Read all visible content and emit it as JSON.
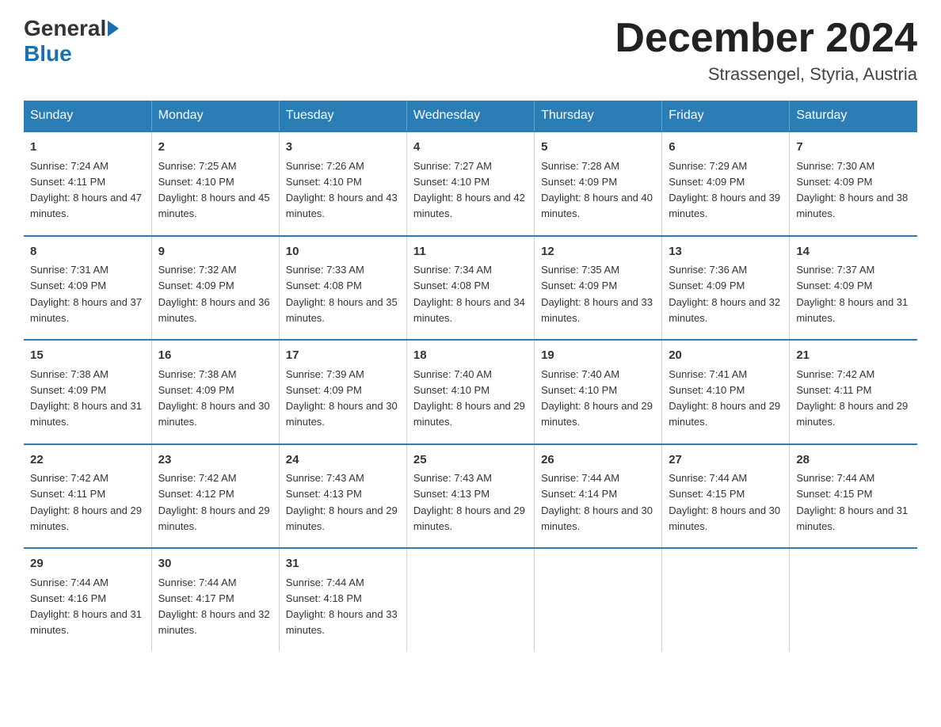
{
  "header": {
    "logo_general": "General",
    "logo_blue": "Blue",
    "month_title": "December 2024",
    "location": "Strassengel, Styria, Austria"
  },
  "days_of_week": [
    "Sunday",
    "Monday",
    "Tuesday",
    "Wednesday",
    "Thursday",
    "Friday",
    "Saturday"
  ],
  "weeks": [
    [
      {
        "day": "1",
        "sunrise": "7:24 AM",
        "sunset": "4:11 PM",
        "daylight": "8 hours and 47 minutes."
      },
      {
        "day": "2",
        "sunrise": "7:25 AM",
        "sunset": "4:10 PM",
        "daylight": "8 hours and 45 minutes."
      },
      {
        "day": "3",
        "sunrise": "7:26 AM",
        "sunset": "4:10 PM",
        "daylight": "8 hours and 43 minutes."
      },
      {
        "day": "4",
        "sunrise": "7:27 AM",
        "sunset": "4:10 PM",
        "daylight": "8 hours and 42 minutes."
      },
      {
        "day": "5",
        "sunrise": "7:28 AM",
        "sunset": "4:09 PM",
        "daylight": "8 hours and 40 minutes."
      },
      {
        "day": "6",
        "sunrise": "7:29 AM",
        "sunset": "4:09 PM",
        "daylight": "8 hours and 39 minutes."
      },
      {
        "day": "7",
        "sunrise": "7:30 AM",
        "sunset": "4:09 PM",
        "daylight": "8 hours and 38 minutes."
      }
    ],
    [
      {
        "day": "8",
        "sunrise": "7:31 AM",
        "sunset": "4:09 PM",
        "daylight": "8 hours and 37 minutes."
      },
      {
        "day": "9",
        "sunrise": "7:32 AM",
        "sunset": "4:09 PM",
        "daylight": "8 hours and 36 minutes."
      },
      {
        "day": "10",
        "sunrise": "7:33 AM",
        "sunset": "4:08 PM",
        "daylight": "8 hours and 35 minutes."
      },
      {
        "day": "11",
        "sunrise": "7:34 AM",
        "sunset": "4:08 PM",
        "daylight": "8 hours and 34 minutes."
      },
      {
        "day": "12",
        "sunrise": "7:35 AM",
        "sunset": "4:09 PM",
        "daylight": "8 hours and 33 minutes."
      },
      {
        "day": "13",
        "sunrise": "7:36 AM",
        "sunset": "4:09 PM",
        "daylight": "8 hours and 32 minutes."
      },
      {
        "day": "14",
        "sunrise": "7:37 AM",
        "sunset": "4:09 PM",
        "daylight": "8 hours and 31 minutes."
      }
    ],
    [
      {
        "day": "15",
        "sunrise": "7:38 AM",
        "sunset": "4:09 PM",
        "daylight": "8 hours and 31 minutes."
      },
      {
        "day": "16",
        "sunrise": "7:38 AM",
        "sunset": "4:09 PM",
        "daylight": "8 hours and 30 minutes."
      },
      {
        "day": "17",
        "sunrise": "7:39 AM",
        "sunset": "4:09 PM",
        "daylight": "8 hours and 30 minutes."
      },
      {
        "day": "18",
        "sunrise": "7:40 AM",
        "sunset": "4:10 PM",
        "daylight": "8 hours and 29 minutes."
      },
      {
        "day": "19",
        "sunrise": "7:40 AM",
        "sunset": "4:10 PM",
        "daylight": "8 hours and 29 minutes."
      },
      {
        "day": "20",
        "sunrise": "7:41 AM",
        "sunset": "4:10 PM",
        "daylight": "8 hours and 29 minutes."
      },
      {
        "day": "21",
        "sunrise": "7:42 AM",
        "sunset": "4:11 PM",
        "daylight": "8 hours and 29 minutes."
      }
    ],
    [
      {
        "day": "22",
        "sunrise": "7:42 AM",
        "sunset": "4:11 PM",
        "daylight": "8 hours and 29 minutes."
      },
      {
        "day": "23",
        "sunrise": "7:42 AM",
        "sunset": "4:12 PM",
        "daylight": "8 hours and 29 minutes."
      },
      {
        "day": "24",
        "sunrise": "7:43 AM",
        "sunset": "4:13 PM",
        "daylight": "8 hours and 29 minutes."
      },
      {
        "day": "25",
        "sunrise": "7:43 AM",
        "sunset": "4:13 PM",
        "daylight": "8 hours and 29 minutes."
      },
      {
        "day": "26",
        "sunrise": "7:44 AM",
        "sunset": "4:14 PM",
        "daylight": "8 hours and 30 minutes."
      },
      {
        "day": "27",
        "sunrise": "7:44 AM",
        "sunset": "4:15 PM",
        "daylight": "8 hours and 30 minutes."
      },
      {
        "day": "28",
        "sunrise": "7:44 AM",
        "sunset": "4:15 PM",
        "daylight": "8 hours and 31 minutes."
      }
    ],
    [
      {
        "day": "29",
        "sunrise": "7:44 AM",
        "sunset": "4:16 PM",
        "daylight": "8 hours and 31 minutes."
      },
      {
        "day": "30",
        "sunrise": "7:44 AM",
        "sunset": "4:17 PM",
        "daylight": "8 hours and 32 minutes."
      },
      {
        "day": "31",
        "sunrise": "7:44 AM",
        "sunset": "4:18 PM",
        "daylight": "8 hours and 33 minutes."
      },
      {
        "day": "",
        "sunrise": "",
        "sunset": "",
        "daylight": ""
      },
      {
        "day": "",
        "sunrise": "",
        "sunset": "",
        "daylight": ""
      },
      {
        "day": "",
        "sunrise": "",
        "sunset": "",
        "daylight": ""
      },
      {
        "day": "",
        "sunrise": "",
        "sunset": "",
        "daylight": ""
      }
    ]
  ],
  "labels": {
    "sunrise_prefix": "Sunrise: ",
    "sunset_prefix": "Sunset: ",
    "daylight_prefix": "Daylight: "
  }
}
